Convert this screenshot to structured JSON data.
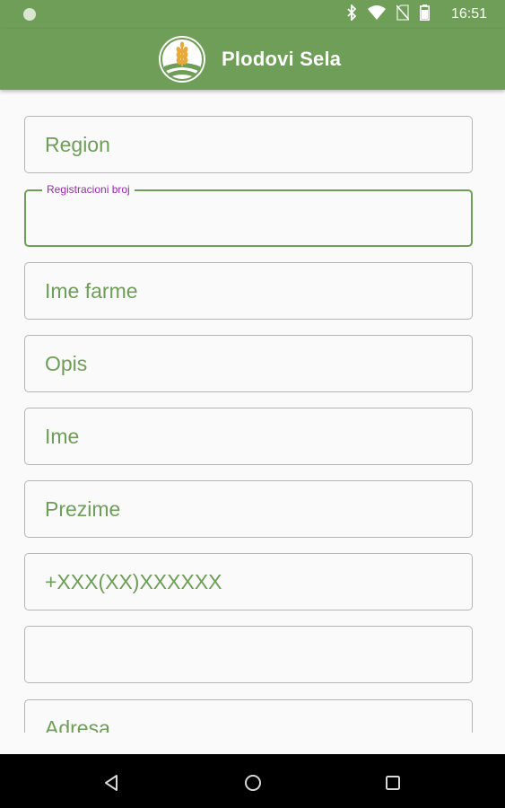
{
  "status_bar": {
    "time": "16:51",
    "icons": [
      "notification-dot-icon",
      "bluetooth-icon",
      "wifi-icon",
      "no-sim-icon",
      "battery-icon"
    ]
  },
  "app_bar": {
    "title": "Plodovi Sela",
    "logo_icon": "wheat-logo-icon"
  },
  "form": {
    "fields": [
      {
        "id": "region",
        "value": "Region"
      },
      {
        "id": "registracioni-broj",
        "label": "Registracioni broj",
        "value": "",
        "focused": true
      },
      {
        "id": "ime-farme",
        "value": "Ime farme"
      },
      {
        "id": "opis",
        "value": "Opis"
      },
      {
        "id": "ime",
        "value": "Ime"
      },
      {
        "id": "prezime",
        "value": "Prezime"
      },
      {
        "id": "telefon",
        "value": "+XXX(XX)XXXXXX"
      },
      {
        "id": "empty",
        "value": ""
      },
      {
        "id": "adresa",
        "value": "Adresa"
      }
    ]
  },
  "nav_bar": {
    "buttons": [
      "back-icon",
      "home-icon",
      "recents-icon"
    ]
  },
  "colors": {
    "primary": "#6e9e58",
    "focus_label": "#9a27b0",
    "field_border": "#b5b5b5"
  }
}
